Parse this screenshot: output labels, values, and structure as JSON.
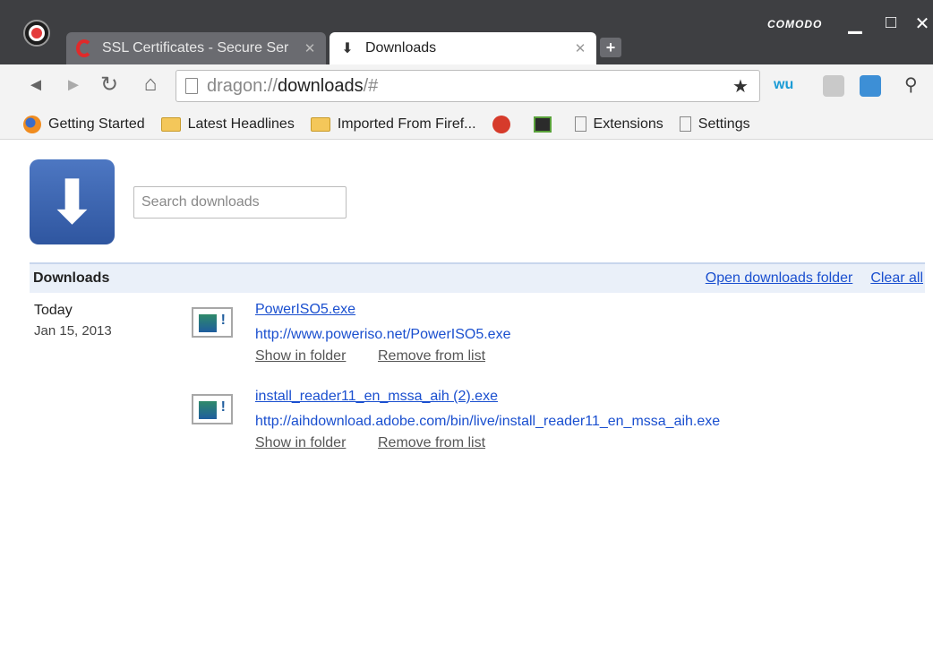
{
  "window": {
    "brand": "COMODO",
    "controls": {
      "minimize": "▁",
      "maximize": "□",
      "close": "✕"
    }
  },
  "tabs": [
    {
      "title": "SSL Certificates - Secure Ser",
      "close": "✕",
      "icon": "comodo-c-icon"
    },
    {
      "title": "Downloads",
      "close": "✕",
      "icon": "download-arrow-icon"
    }
  ],
  "new_tab_label": "+",
  "toolbar": {
    "back": "◄",
    "forward": "►",
    "reload": "↻",
    "home": "⌂",
    "url_scheme": "dragon://",
    "url_main": "downloads",
    "url_tail": "/#",
    "star": "★",
    "ext1": "wu",
    "ext4": "⚲"
  },
  "bookmarks": [
    {
      "label": "Getting Started",
      "icon": "firefox-icon"
    },
    {
      "label": "Latest Headlines",
      "icon": "folder-icon"
    },
    {
      "label": "Imported From Firef...",
      "icon": "folder-icon"
    },
    {
      "label": "",
      "icon": "angry-bird-icon"
    },
    {
      "label": "",
      "icon": "film-icon"
    },
    {
      "label": "Extensions",
      "icon": "page-icon"
    },
    {
      "label": "Settings",
      "icon": "page-icon"
    }
  ],
  "page": {
    "big_icon_glyph": "⬇",
    "search_placeholder": "Search downloads",
    "section_title": "Downloads",
    "open_folder": "Open downloads folder",
    "clear_all": "Clear all",
    "date_label": "Today",
    "date_full": "Jan 15, 2013",
    "items": [
      {
        "name": "PowerISO5.exe",
        "url": "http://www.poweriso.net/PowerISO5.exe",
        "show": "Show in folder",
        "remove": "Remove from list"
      },
      {
        "name": "install_reader11_en_mssa_aih (2).exe",
        "url": "http://aihdownload.adobe.com/bin/live/install_reader11_en_mssa_aih.exe",
        "show": "Show in folder",
        "remove": "Remove from list"
      }
    ]
  },
  "colors": {
    "link": "#1a4fcf",
    "titlebar": "#3e3f42",
    "header_band": "#eaf0f9"
  }
}
